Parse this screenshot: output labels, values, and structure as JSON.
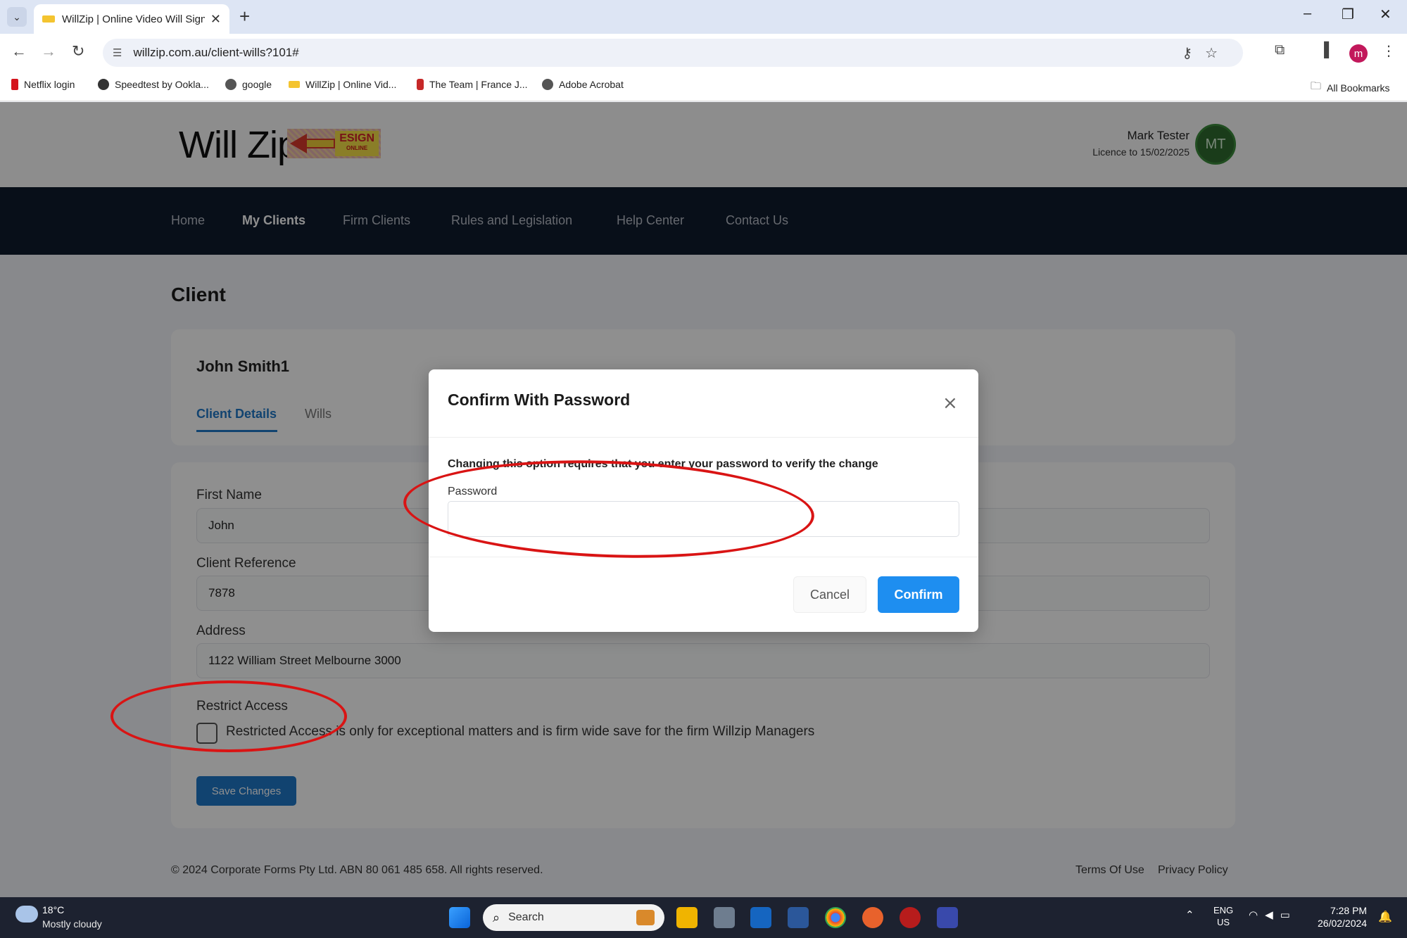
{
  "browser": {
    "tab_title": "WillZip | Online Video Will Sign",
    "new_tab": "+",
    "url": "willzip.com.au/client-wills?101#",
    "bookmarks": [
      "Netflix login",
      "Speedtest by Ookla...",
      "google",
      "WillZip | Online Vid...",
      "The Team | France J...",
      "Adobe Acrobat"
    ],
    "all_bookmarks": "All Bookmarks",
    "profile_initial": "m"
  },
  "site": {
    "logo_text": "Will Zip",
    "logo_badge_main": "ESIGN",
    "logo_badge_sub": "ONLINE",
    "user_name": "Mark Tester",
    "user_licence": "Licence to 15/02/2025",
    "user_initials": "MT"
  },
  "nav": {
    "items": [
      {
        "label": "Home"
      },
      {
        "label": "My Clients"
      },
      {
        "label": "Firm Clients"
      },
      {
        "label": "Rules and Legislation"
      },
      {
        "label": "Help Center"
      },
      {
        "label": "Contact Us"
      }
    ],
    "active": "My Clients"
  },
  "client_page": {
    "title": "Client",
    "client_name": "John Smith1",
    "tabs": [
      {
        "label": "Client Details"
      },
      {
        "label": "Wills"
      }
    ],
    "fields": {
      "first_name_label": "First Name",
      "first_name_value": "John",
      "client_reference_label": "Client Reference",
      "client_reference_value": "7878",
      "address_label": "Address",
      "address_value": "1122 William Street Melbourne 3000"
    },
    "restrict_access_label": "Restrict Access",
    "restrict_access_text": "Restricted Access is only for exceptional matters and is firm wide save for the firm Willzip Managers",
    "restrict_access_checked": false,
    "save_button": "Save Changes"
  },
  "modal": {
    "title": "Confirm With Password",
    "close": "×",
    "message": "Changing this option requires that you enter your password to verify the change",
    "password_label": "Password",
    "password_value": "",
    "cancel": "Cancel",
    "confirm": "Confirm"
  },
  "footer": {
    "copyright": "© 2024 Corporate Forms Pty Ltd. ABN 80 061 485 658. All rights reserved.",
    "terms": "Terms Of Use",
    "privacy": "Privacy Policy"
  },
  "taskbar": {
    "weather_temp": "18°C",
    "weather_desc": "Mostly cloudy",
    "search_placeholder": "Search",
    "lang_top": "ENG",
    "lang_bottom": "US",
    "time": "7:28 PM",
    "date": "26/02/2024"
  },
  "colors": {
    "nav_bg": "#0f1b2d",
    "accent_blue": "#1f78c8",
    "confirm_blue": "#1e8ef0",
    "annotation_red": "#d91414",
    "avatar_green": "#2f6b2f"
  }
}
